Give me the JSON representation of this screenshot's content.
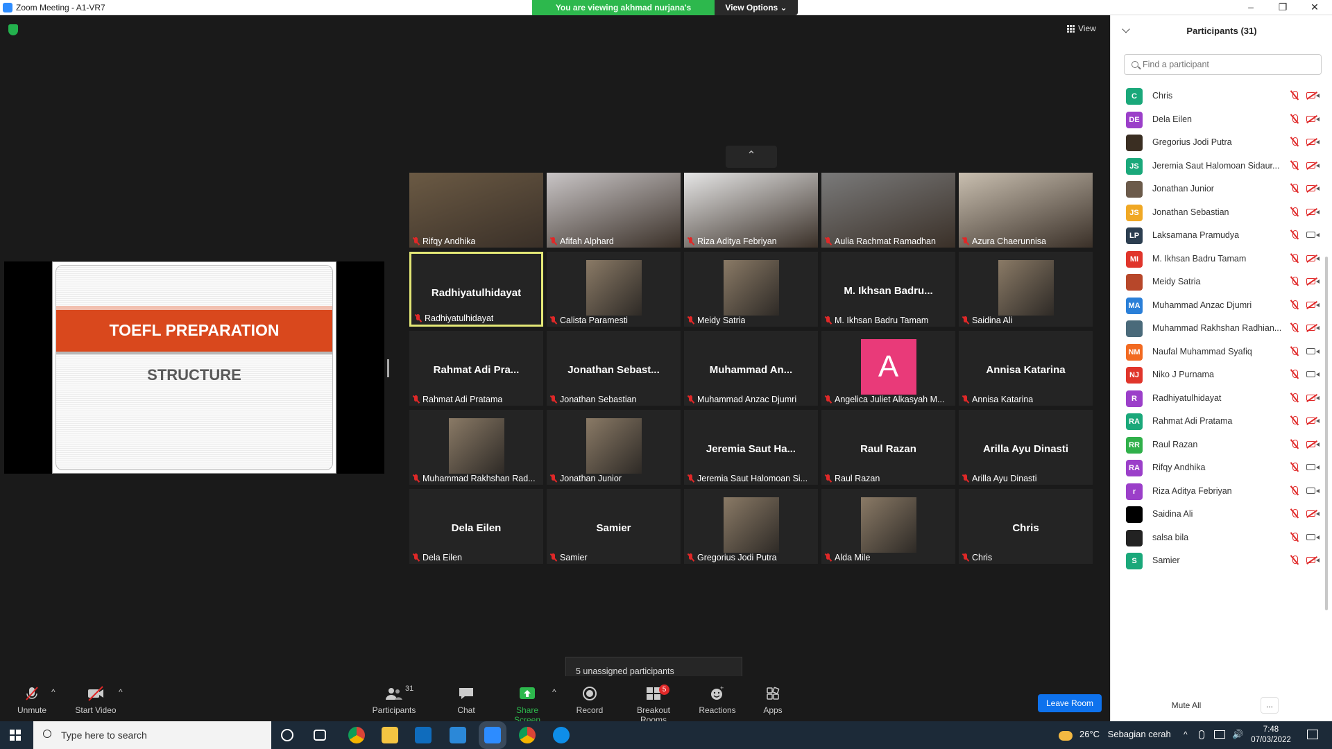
{
  "window": {
    "title": "Zoom Meeting - A1-VR7",
    "minimize": "–",
    "maximize": "❐",
    "close": "✕"
  },
  "share_banner": {
    "viewing": "You are viewing akhmad nurjana's screen",
    "view_options": "View Options ⌄"
  },
  "view_button": {
    "label": "View"
  },
  "slide": {
    "title": "TOEFL PREPARATION",
    "subtitle": "STRUCTURE"
  },
  "gallery": {
    "tiles": [
      {
        "label": "Rifqy Andhika",
        "type": "video"
      },
      {
        "label": "Afifah Alphard",
        "type": "video"
      },
      {
        "label": "Riza Aditya Febriyan",
        "type": "video"
      },
      {
        "label": "Aulia Rachmat Ramadhan",
        "type": "video"
      },
      {
        "label": "Azura Chaerunnisa",
        "type": "video"
      },
      {
        "label": "Radhiyatulhidayat",
        "big": "Radhiyatulhidayat",
        "type": "name",
        "active": true
      },
      {
        "label": "Calista Paramesti",
        "type": "pic"
      },
      {
        "label": "Meidy Satria",
        "type": "pic"
      },
      {
        "label": "M. Ikhsan Badru Tamam",
        "big": "M. Ikhsan Badru...",
        "type": "name"
      },
      {
        "label": "Saidina Ali",
        "type": "pic"
      },
      {
        "label": "Rahmat Adi Pratama",
        "big": "Rahmat Adi Pra...",
        "type": "name"
      },
      {
        "label": "Jonathan Sebastian",
        "big": "Jonathan Sebast...",
        "type": "name"
      },
      {
        "label": "Muhammad Anzac Djumri",
        "big": "Muhammad An...",
        "type": "name"
      },
      {
        "label": "Angelica Juliet Alkasyah M...",
        "avatar_letter": "A",
        "type": "letter"
      },
      {
        "label": "Annisa Katarina",
        "big": "Annisa Katarina",
        "type": "name"
      },
      {
        "label": "Muhammad Rakhshan Rad...",
        "type": "pic"
      },
      {
        "label": "Jonathan Junior",
        "type": "pic"
      },
      {
        "label": "Jeremia Saut Halomoan Si...",
        "big": "Jeremia Saut Ha...",
        "type": "name"
      },
      {
        "label": "Raul Razan",
        "big": "Raul Razan",
        "type": "name"
      },
      {
        "label": "Arilla Ayu Dinasti",
        "big": "Arilla Ayu Dinasti",
        "type": "name"
      },
      {
        "label": "Dela Eilen",
        "big": "Dela Eilen",
        "type": "name"
      },
      {
        "label": "Samier",
        "big": "Samier",
        "type": "name"
      },
      {
        "label": "Gregorius Jodi Putra",
        "type": "pic"
      },
      {
        "label": "Alda Mile",
        "type": "pic"
      },
      {
        "label": "Chris",
        "big": "Chris",
        "type": "name"
      }
    ]
  },
  "unassigned": "5 unassigned participants",
  "toolbar": {
    "unmute": "Unmute",
    "start_video": "Start Video",
    "participants": "Participants",
    "participants_count": "31",
    "chat": "Chat",
    "share_screen": "Share Screen",
    "record": "Record",
    "breakout_rooms": "Breakout Rooms",
    "breakout_badge": "5",
    "reactions": "Reactions",
    "apps": "Apps",
    "leave": "Leave Room"
  },
  "panel": {
    "title": "Participants (31)",
    "search_placeholder": "Find a participant",
    "participants": [
      {
        "initials": "C",
        "name": "Chris",
        "color": "#1aa87a",
        "video": "off"
      },
      {
        "initials": "DE",
        "name": "Dela Eilen",
        "color": "#9b3fc9",
        "video": "off"
      },
      {
        "initials": "",
        "name": "Gregorius Jodi Putra",
        "color": "#3a2e22",
        "video": "off"
      },
      {
        "initials": "JS",
        "name": "Jeremia Saut Halomoan Sidaur...",
        "color": "#1aa87a",
        "video": "off"
      },
      {
        "initials": "",
        "name": "Jonathan Junior",
        "color": "#6b5a4a",
        "video": "off"
      },
      {
        "initials": "JS",
        "name": "Jonathan Sebastian",
        "color": "#f0a824",
        "video": "off"
      },
      {
        "initials": "LP",
        "name": "Laksamana Pramudya",
        "color": "#2c3e50",
        "video": "on"
      },
      {
        "initials": "MI",
        "name": "M. Ikhsan Badru Tamam",
        "color": "#e0352b",
        "video": "off"
      },
      {
        "initials": "",
        "name": "Meidy Satria",
        "color": "#b7472a",
        "video": "off"
      },
      {
        "initials": "MA",
        "name": "Muhammad Anzac Djumri",
        "color": "#2a7fd8",
        "video": "off"
      },
      {
        "initials": "",
        "name": "Muhammad Rakhshan Radhian...",
        "color": "#4a6a7a",
        "video": "off"
      },
      {
        "initials": "NM",
        "name": "Naufal Muhammad Syafiq",
        "color": "#f26a21",
        "video": "on"
      },
      {
        "initials": "NJ",
        "name": "Niko J Purnama",
        "color": "#e0352b",
        "video": "on"
      },
      {
        "initials": "R",
        "name": "Radhiyatulhidayat",
        "color": "#9b3fc9",
        "video": "off"
      },
      {
        "initials": "RA",
        "name": "Rahmat Adi Pratama",
        "color": "#1aa87a",
        "video": "off"
      },
      {
        "initials": "RR",
        "name": "Raul Razan",
        "color": "#30b04a",
        "video": "off"
      },
      {
        "initials": "RA",
        "name": "Rifqy Andhika",
        "color": "#9b3fc9",
        "video": "on"
      },
      {
        "initials": "r",
        "name": "Riza Aditya Febriyan",
        "color": "#9b3fc9",
        "video": "on"
      },
      {
        "initials": "",
        "name": "Saidina Ali",
        "color": "#000000",
        "video": "off"
      },
      {
        "initials": "",
        "name": "salsa bila",
        "color": "#222222",
        "video": "on"
      },
      {
        "initials": "S",
        "name": "Samier",
        "color": "#1aa87a",
        "video": "off"
      }
    ],
    "mute_all": "Mute All",
    "more": "..."
  },
  "taskbar": {
    "search_placeholder": "Type here to search",
    "weather_temp": "26°C",
    "weather_desc": "Sebagian cerah",
    "time": "7:48",
    "date": "07/03/2022"
  }
}
